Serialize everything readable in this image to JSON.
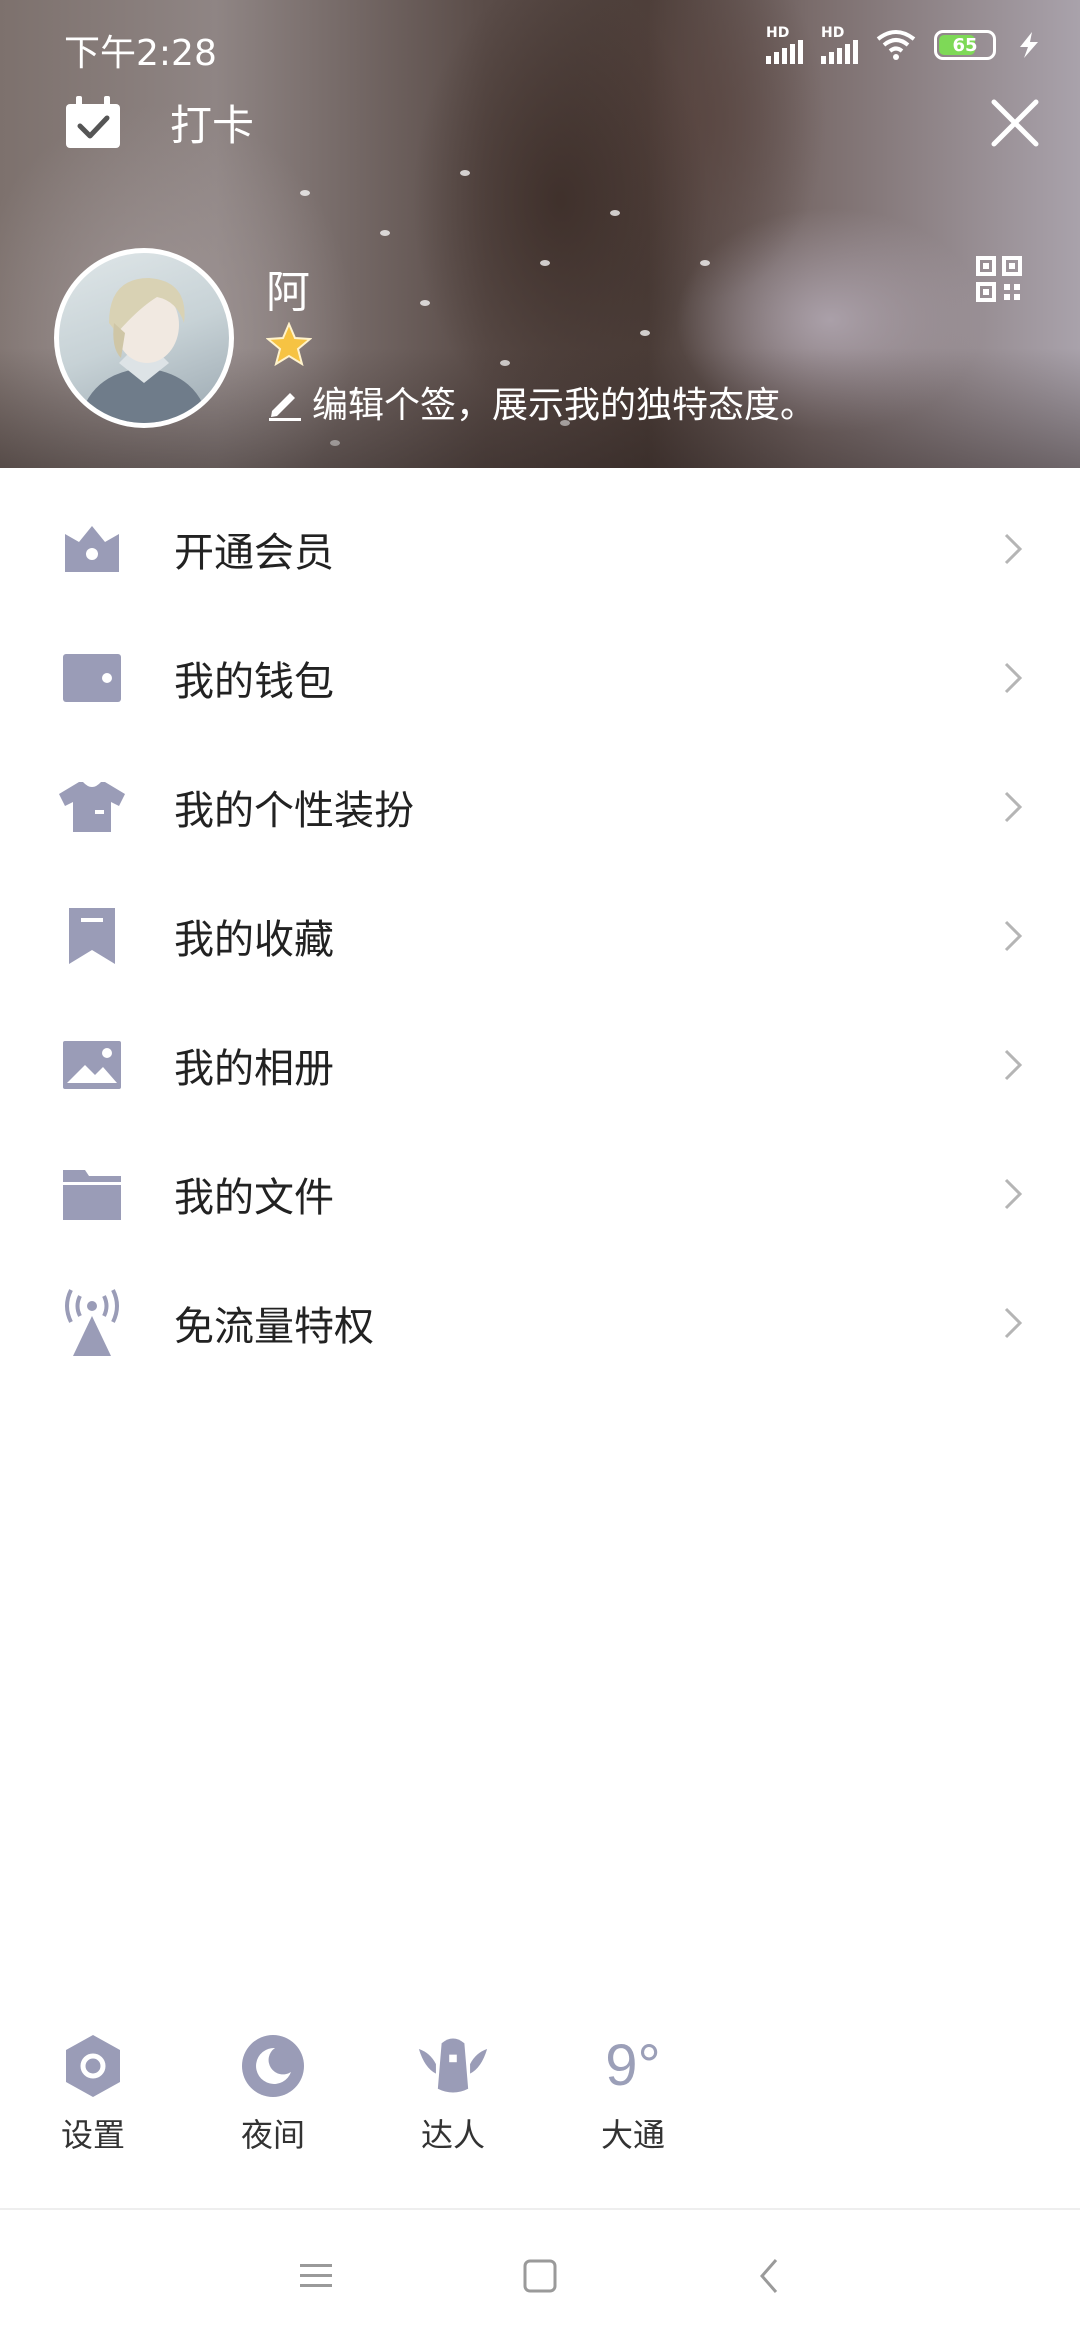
{
  "status_bar": {
    "time": "下午2:28",
    "signal_1_label": "HD",
    "signal_2_label": "HD",
    "battery_level": "65",
    "icons": [
      "signal-icon",
      "signal-icon",
      "wifi-icon",
      "battery-icon",
      "charging-icon"
    ]
  },
  "top_bar": {
    "checkin_label": "打卡",
    "checkin_icon": "calendar-check-icon",
    "close_icon": "close-icon"
  },
  "profile": {
    "nickname": "阿",
    "badge_icon": "star-icon",
    "signature": "编辑个签，展示我的独特态度。",
    "signature_icon": "pencil-icon",
    "qr_icon": "qr-code-icon"
  },
  "menu": {
    "items": [
      {
        "label": "开通会员",
        "icon": "crown-icon"
      },
      {
        "label": "我的钱包",
        "icon": "wallet-icon"
      },
      {
        "label": "我的个性装扮",
        "icon": "tshirt-icon"
      },
      {
        "label": "我的收藏",
        "icon": "bookmark-icon"
      },
      {
        "label": "我的相册",
        "icon": "photo-icon"
      },
      {
        "label": "我的文件",
        "icon": "folder-icon"
      },
      {
        "label": "免流量特权",
        "icon": "broadcast-icon"
      }
    ]
  },
  "quick_actions": {
    "settings": {
      "label": "设置",
      "icon": "gear-icon"
    },
    "night": {
      "label": "夜间",
      "icon": "moon-icon"
    },
    "expert": {
      "label": "达人",
      "icon": "penguin-wings-icon"
    },
    "weather": {
      "label": "大通",
      "temperature": "9°"
    }
  },
  "nav_bar": {
    "icons": [
      "menu-icon",
      "home-icon",
      "back-icon"
    ]
  },
  "colors": {
    "icon_gray": "#9a9cb7",
    "text_dark": "#222222",
    "chevron": "#b5b5b5"
  }
}
